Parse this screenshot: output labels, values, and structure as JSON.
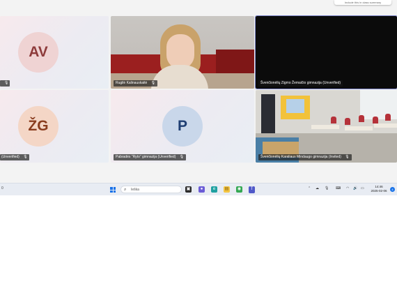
{
  "notification": {
    "text": "Include this in class summary"
  },
  "tiles": [
    {
      "initials": "AV",
      "name": "",
      "avatar_bg": "#efd3d3",
      "avatar_fg": "#8d3b3b"
    },
    {
      "name": "Rugilė Kalinauskaitė"
    },
    {
      "name": "Švenčionėlių Zigmo Žemaičio gimnazija (Unverified)"
    },
    {
      "initials": "ŽG",
      "name": "(Unverified)",
      "avatar_bg": "#f4d6c6",
      "avatar_fg": "#8a3d1f"
    },
    {
      "initials": "P",
      "name": "Pabradės \"Ryto\" gimnazija (Unverified)",
      "avatar_bg": "#c9d7ea",
      "avatar_fg": "#1f3f73"
    },
    {
      "name": "Švenčionėlių Karaliaus Mindaugo gimnazija (Invited)"
    }
  ],
  "taskbar": {
    "left_text": "0",
    "search_placeholder": "Ieška",
    "time": "14:46",
    "date": "2025-02-06",
    "notification_count": "4"
  },
  "colors": {
    "accent": "#7f87c9",
    "taskbar_bg": "#e8ecf3",
    "brand_blue": "#1a73e8"
  }
}
